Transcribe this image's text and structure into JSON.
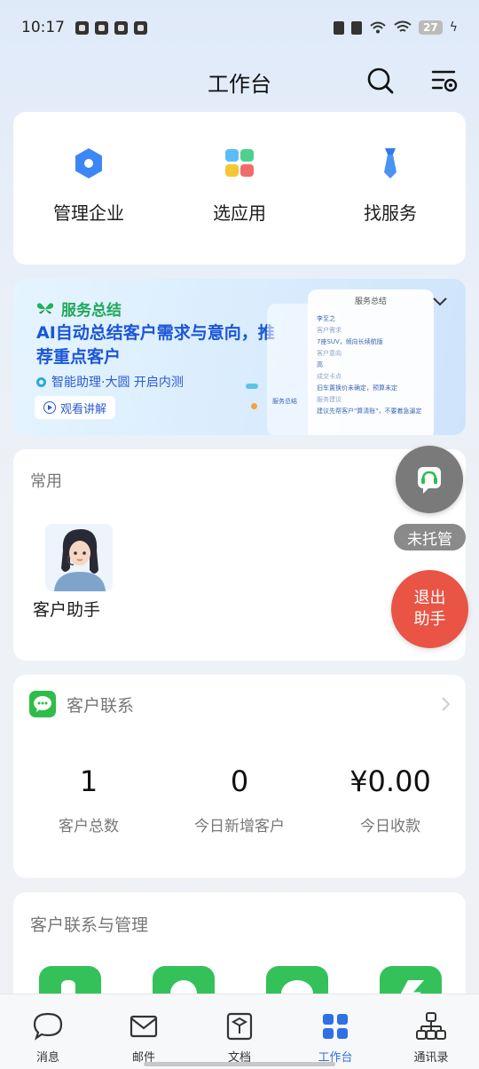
{
  "status_bar": {
    "time": "10:17",
    "battery": "27"
  },
  "nav": {
    "title": "工作台",
    "search_icon": "search-icon",
    "settings_icon": "list-settings-icon"
  },
  "quick_actions": [
    {
      "label": "管理企业",
      "icon": "hexagon-icon",
      "color": "#3b87f5"
    },
    {
      "label": "选应用",
      "icon": "app-grid-icon",
      "color": "#f5a623"
    },
    {
      "label": "找服务",
      "icon": "tie-icon",
      "color": "#3b87f5"
    }
  ],
  "banner": {
    "tag": "服务总结",
    "title": "AI自动总结客户需求与意向，推荐重点客户",
    "subtitle": "智能助理·大圆 开启内测",
    "button": "观看讲解",
    "mock": {
      "title": "服务总结",
      "name": "李至之",
      "lines": [
        {
          "label": "客户需求",
          "value": "7座SUV，倾向长续航版"
        },
        {
          "label": "客户意向",
          "value": "高"
        },
        {
          "label": "成交卡点",
          "value": "旧车置换价未确定，预算未定"
        },
        {
          "label": "服务建议",
          "value": "建议先帮客户\"算清账\"，不要着急逼定"
        }
      ],
      "side_tag": "服务总结"
    }
  },
  "common": {
    "title": "常用",
    "assistant_label": "客户助手"
  },
  "floating": {
    "status_label": "未托管",
    "exit_line1": "退出",
    "exit_line2": "助手"
  },
  "customer_contact": {
    "title": "客户联系",
    "stats": [
      {
        "value": "1",
        "label": "客户总数"
      },
      {
        "value": "0",
        "label": "今日新增客户"
      },
      {
        "value": "¥0.00",
        "label": "今日收款"
      }
    ]
  },
  "manage": {
    "title": "客户联系与管理"
  },
  "tabs": [
    {
      "label": "消息",
      "icon": "chat-bubble-icon"
    },
    {
      "label": "邮件",
      "icon": "mail-icon"
    },
    {
      "label": "文档",
      "icon": "document-icon"
    },
    {
      "label": "工作台",
      "icon": "workbench-grid-icon",
      "active": true
    },
    {
      "label": "通讯录",
      "icon": "contacts-tree-icon"
    }
  ],
  "colors": {
    "accent": "#2f6fe8",
    "green": "#35c15a",
    "exit_red": "#e95445"
  }
}
